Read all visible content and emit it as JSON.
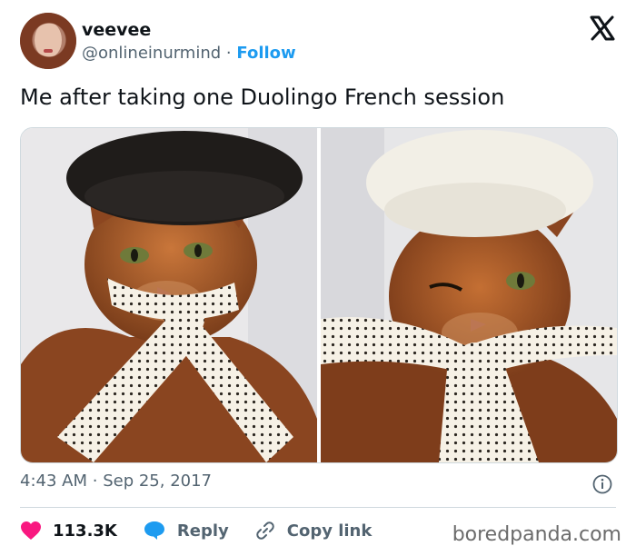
{
  "author": {
    "display_name": "veevee",
    "handle": "@onlineinurmind",
    "separator": "·",
    "follow_label": "Follow"
  },
  "tweet": {
    "text": "Me after taking one Duolingo French session",
    "time": "4:43 AM",
    "date": "Sep 25, 2017",
    "meta_separator": "·"
  },
  "actions": {
    "likes_count": "113.3K",
    "reply_label": "Reply",
    "copy_link_label": "Copy link"
  },
  "watermark": "boredpanda.com",
  "icons": {
    "brand": "x-logo-icon",
    "info": "info-icon",
    "like": "heart-icon",
    "reply": "speech-bubble-icon",
    "copy": "link-icon"
  },
  "colors": {
    "link": "#1d9bf0",
    "heart": "#f91880",
    "text": "#0f1419",
    "muted": "#536471",
    "border": "#cfd9de"
  }
}
